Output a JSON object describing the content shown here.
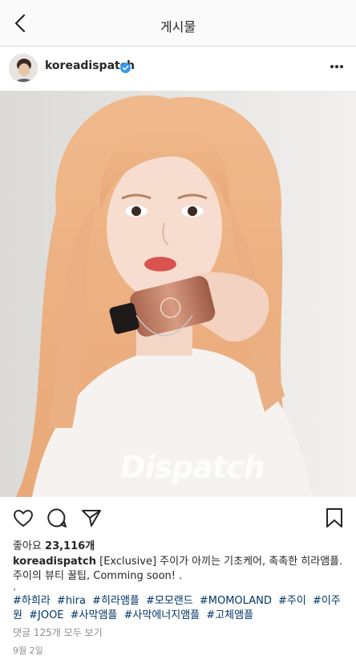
{
  "topbar": {
    "title": "게시물"
  },
  "post": {
    "username": "koreadispatch",
    "watermark": "Dispatch",
    "likes_label": "좋아요",
    "likes_count": "23,116개",
    "caption_text": "[Exclusive] 주이가 아끼는 기초케어, 촉촉한 히라앰플. 주이의 뷰티 꿀팁, Comming soon! .",
    "caption_dot": ".",
    "hashtags": [
      "#하희라",
      "#hira",
      "#히라앰플",
      "#모모랜드",
      "#MOMOLAND",
      "#주이",
      "#이주원",
      "#JOOE",
      "#사막앰플",
      "#사막에너지앰플",
      "#고체앰플"
    ],
    "comments_link": "댓글 125개 모두 보기",
    "date": "9월 2일"
  },
  "colors": {
    "hashtag": "#003569",
    "verified": "#3897f0",
    "muted": "#8e8e8e"
  },
  "icons": [
    "back-arrow-icon",
    "verified-badge-icon",
    "more-options-icon",
    "heart-icon",
    "comment-icon",
    "share-icon",
    "bookmark-icon"
  ]
}
